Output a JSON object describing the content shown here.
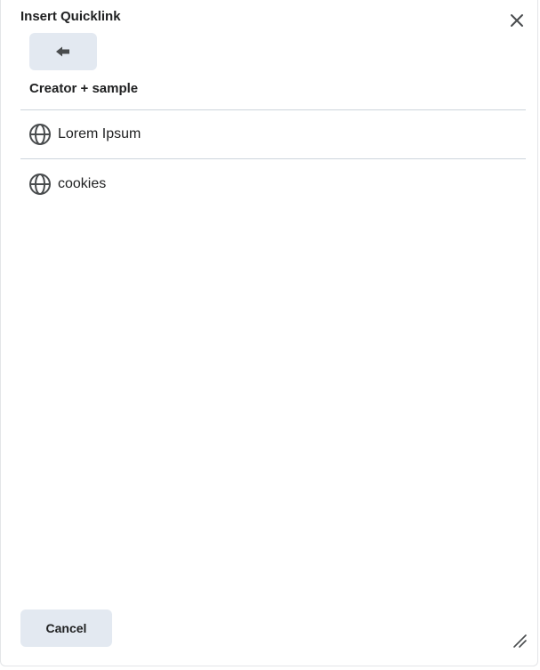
{
  "dialog": {
    "title": "Insert Quicklink",
    "close_icon": "close-icon",
    "back_icon": "arrow-left-icon"
  },
  "folder": {
    "heading": "Creator + sample"
  },
  "links": [
    {
      "label": "Lorem Ipsum",
      "icon": "globe-icon"
    },
    {
      "label": "cookies",
      "icon": "globe-icon"
    }
  ],
  "footer": {
    "cancel_label": "Cancel",
    "resize_icon": "resize-handle-icon"
  },
  "colors": {
    "button_bg": "#e3e9f1",
    "divider": "#cdd5dc",
    "text": "#202122",
    "icon": "#494c4e"
  }
}
